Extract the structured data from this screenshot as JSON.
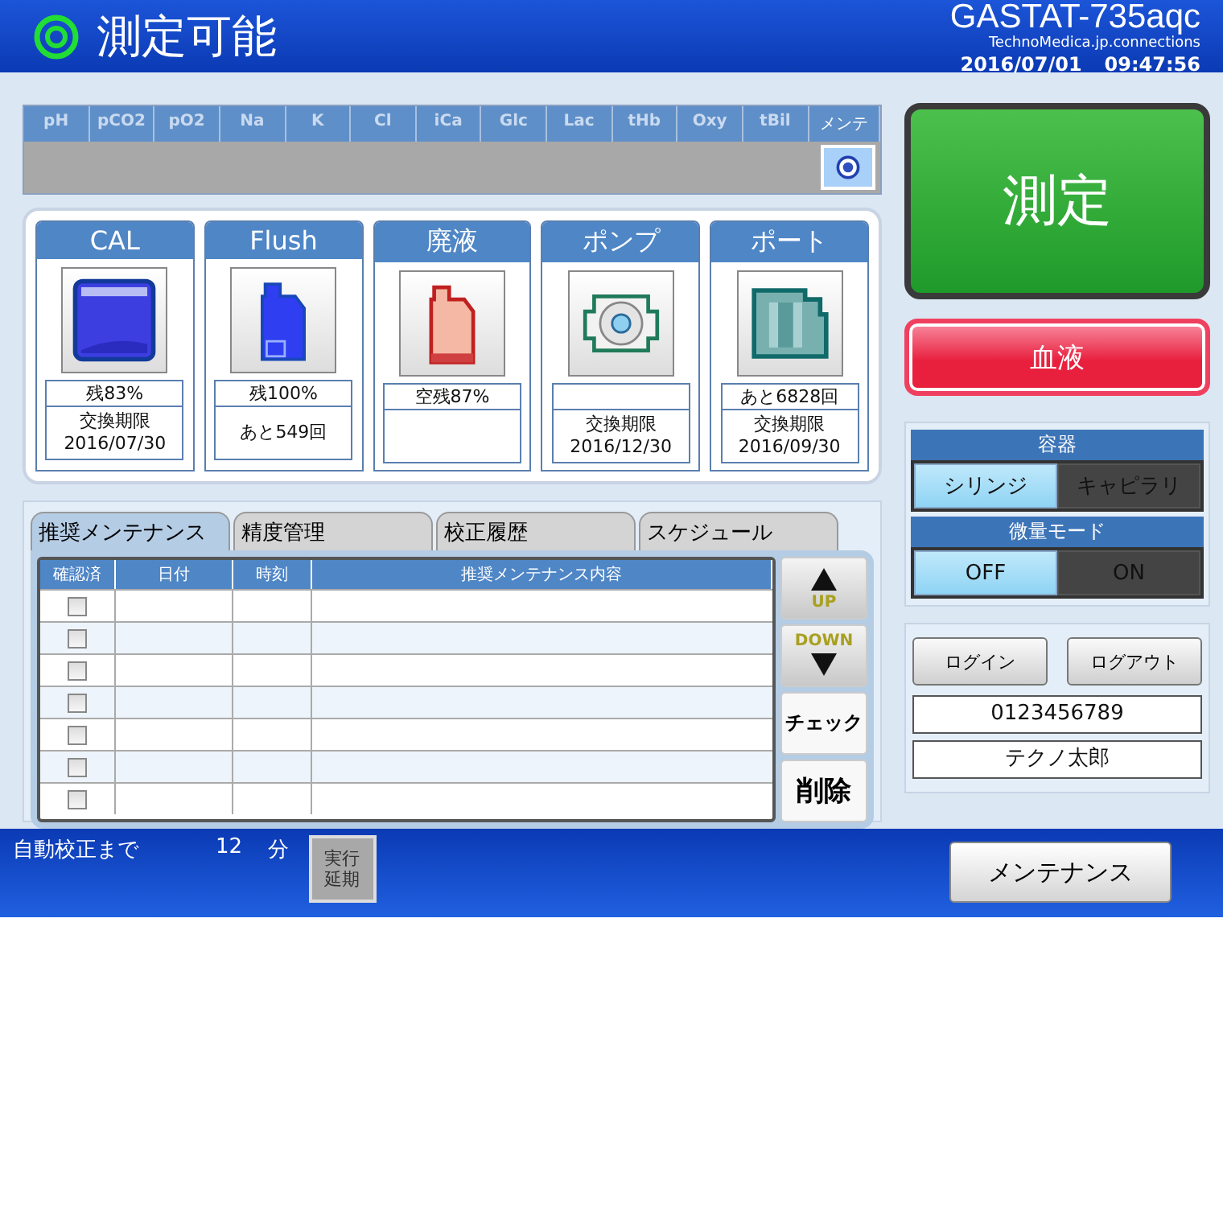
{
  "header": {
    "status": "測定可能",
    "model": "GASTAT-735aqc",
    "domain": "TechnoMedica.jp.connections",
    "date": "2016/07/01",
    "time": "09:47:56"
  },
  "parameters": [
    "pH",
    "pCO2",
    "pO2",
    "Na",
    "K",
    "Cl",
    "iCa",
    "Glc",
    "Lac",
    "tHb",
    "Oxy",
    "tBil"
  ],
  "maintenance": {
    "label": "メンテ"
  },
  "consumables": [
    {
      "name": "CAL",
      "kind": "cal",
      "status": "残83%",
      "info": [
        "交換期限",
        "2016/07/30"
      ]
    },
    {
      "name": "Flush",
      "kind": "flush",
      "status": "残100%",
      "info": [
        "あと549回"
      ]
    },
    {
      "name": "廃液",
      "kind": "waste",
      "status": "空残87%"
    },
    {
      "name": "ポンプ",
      "kind": "pump",
      "info": [
        "交換期限",
        "2016/12/30"
      ]
    },
    {
      "name": "ポート",
      "kind": "port",
      "status": "あと6828回",
      "info": [
        "交換期限",
        "2016/09/30"
      ]
    }
  ],
  "tabs": [
    {
      "label": "推奨メンテナンス",
      "selected": true
    },
    {
      "label": "精度管理",
      "selected": false
    },
    {
      "label": "校正履歴",
      "selected": false
    },
    {
      "label": "スケジュール",
      "selected": false
    }
  ],
  "table": {
    "columns": [
      "確認済",
      "日付",
      "時刻",
      "推奨メンテナンス内容"
    ],
    "rows": [
      {
        "checked": false
      },
      {
        "checked": false
      },
      {
        "checked": false
      },
      {
        "checked": false
      },
      {
        "checked": false
      },
      {
        "checked": false
      },
      {
        "checked": false
      }
    ]
  },
  "side_buttons": [
    {
      "kind": "up",
      "label": "UP"
    },
    {
      "kind": "down",
      "label": "DOWN"
    },
    {
      "kind": "text",
      "label": "チェック"
    },
    {
      "kind": "text",
      "label": "削除"
    }
  ],
  "measure_button": "測定",
  "sample_button": "血液",
  "toggles": [
    {
      "title": "容器",
      "options": [
        {
          "label": "シリンジ",
          "selected": true
        },
        {
          "label": "キャピラリ",
          "selected": false
        }
      ]
    },
    {
      "title": "微量モード",
      "options": [
        {
          "label": "OFF",
          "selected": true
        },
        {
          "label": "ON",
          "selected": false
        }
      ]
    }
  ],
  "login_buttons": [
    "ログイン",
    "ログアウト"
  ],
  "user_id": "0123456789",
  "user_name": "テクノ太郎",
  "footer": {
    "label": "自動校正まで",
    "minutes": "12",
    "unit": "分",
    "postpone_button": [
      "実行",
      "延期"
    ],
    "maintenance_button": "メンテナンス"
  }
}
